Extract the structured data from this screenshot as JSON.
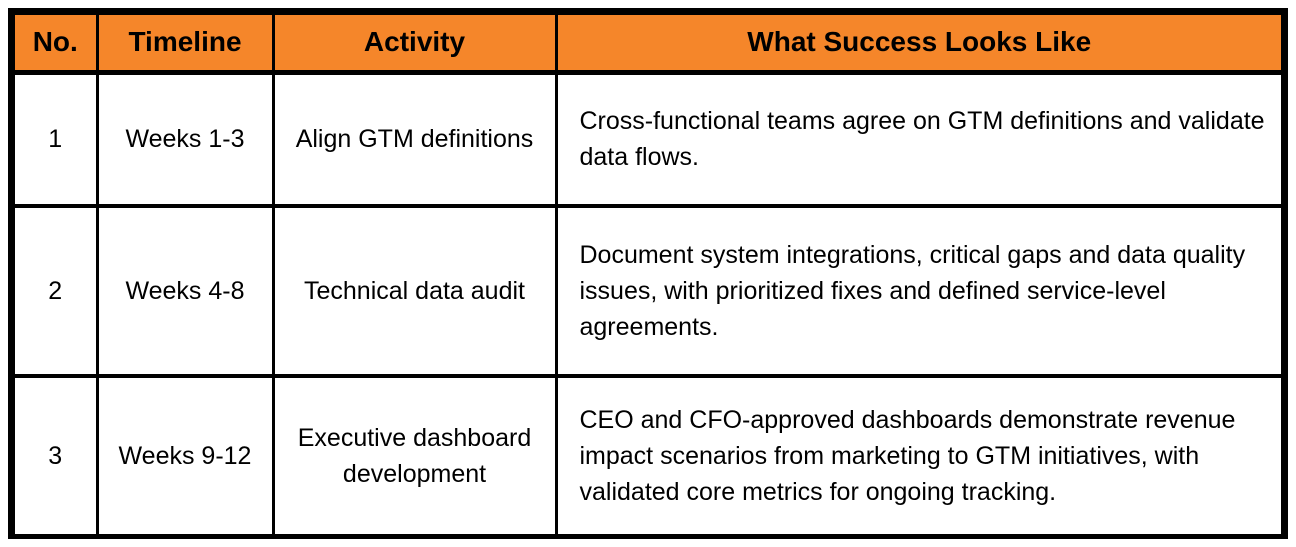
{
  "table": {
    "headers": [
      {
        "label": "No."
      },
      {
        "label": "Timeline"
      },
      {
        "label": "Activity"
      },
      {
        "label": "What Success Looks Like"
      }
    ],
    "rows": [
      {
        "no": "1",
        "timeline": "Weeks 1-3",
        "activity": "Align GTM definitions",
        "success": "Cross-functional teams agree on GTM definitions and validate data flows."
      },
      {
        "no": "2",
        "timeline": "Weeks 4-8",
        "activity": "Technical data audit",
        "success": "Document system integrations, critical gaps and data quality issues, with prioritized fixes and defined service-level agreements."
      },
      {
        "no": "3",
        "timeline": "Weeks 9-12",
        "activity": "Executive dashboard development",
        "success": "CEO and CFO-approved dashboards demonstrate revenue impact scenarios from marketing to GTM initiatives, with validated core metrics for ongoing tracking."
      }
    ]
  },
  "colors": {
    "header_background": "#F5862A",
    "border": "#000000",
    "text": "#000000",
    "cell_background": "#FFFFFF"
  }
}
